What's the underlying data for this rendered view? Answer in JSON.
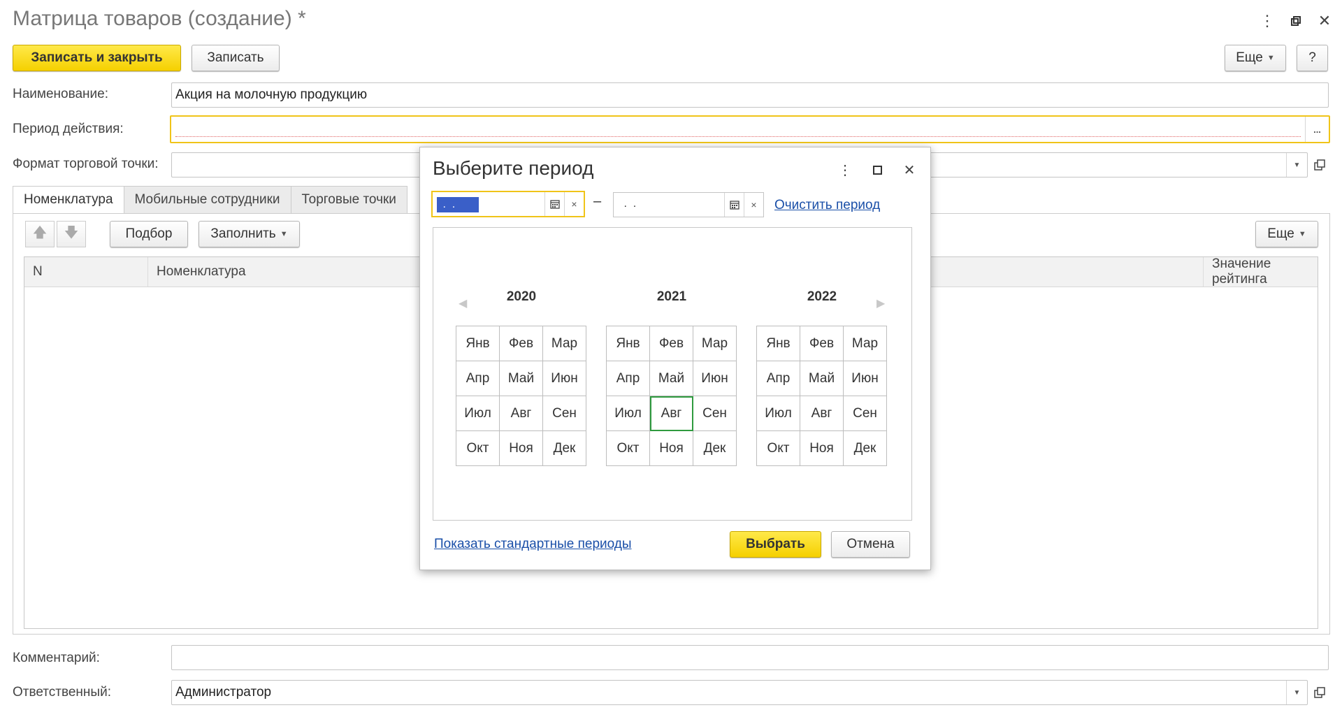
{
  "window": {
    "title": "Матрица товаров (создание) *"
  },
  "toolbar": {
    "save_close": "Записать и закрыть",
    "save": "Записать",
    "more": "Еще",
    "help": "?"
  },
  "form": {
    "name_label": "Наименование:",
    "name_value": "Акция на молочную продукцию",
    "period_label": "Период действия:",
    "period_value": "",
    "period_btn": "...",
    "format_label": "Формат торговой точки:",
    "format_value": "",
    "comment_label": "Комментарий:",
    "comment_value": "",
    "responsible_label": "Ответственный:",
    "responsible_value": "Администратор"
  },
  "tabs": [
    {
      "label": "Номенклатура"
    },
    {
      "label": "Мобильные сотрудники"
    },
    {
      "label": "Торговые точки"
    }
  ],
  "table_toolbar": {
    "pick": "Подбор",
    "fill": "Заполнить",
    "more": "Еще"
  },
  "table": {
    "columns": [
      "N",
      "Номенклатура",
      "Значение рейтинга"
    ]
  },
  "dialog": {
    "title": "Выберите период",
    "from_value": " .  . ",
    "dash": "–",
    "to_value": " .  . ",
    "clear_link": "Очистить период",
    "show_std_link": "Показать стандартные периоды",
    "select_btn": "Выбрать",
    "cancel_btn": "Отмена",
    "years": [
      {
        "year": "2020",
        "months": [
          "Янв",
          "Фев",
          "Мар",
          "Апр",
          "Май",
          "Июн",
          "Июл",
          "Авг",
          "Сен",
          "Окт",
          "Ноя",
          "Дек"
        ]
      },
      {
        "year": "2021",
        "months": [
          "Янв",
          "Фев",
          "Мар",
          "Апр",
          "Май",
          "Июн",
          "Июл",
          "Авг",
          "Сен",
          "Окт",
          "Ноя",
          "Дек"
        ],
        "current_month": "Авг"
      },
      {
        "year": "2022",
        "months": [
          "Янв",
          "Фев",
          "Мар",
          "Апр",
          "Май",
          "Июн",
          "Июл",
          "Авг",
          "Сен",
          "Окт",
          "Ноя",
          "Дек"
        ]
      }
    ]
  },
  "colors": {
    "accent_yellow": "#f5d000",
    "focus_border": "#f0c419",
    "link": "#1a4fa8",
    "current_month_border": "#2f9a3f",
    "selection": "#3a5fc8"
  }
}
